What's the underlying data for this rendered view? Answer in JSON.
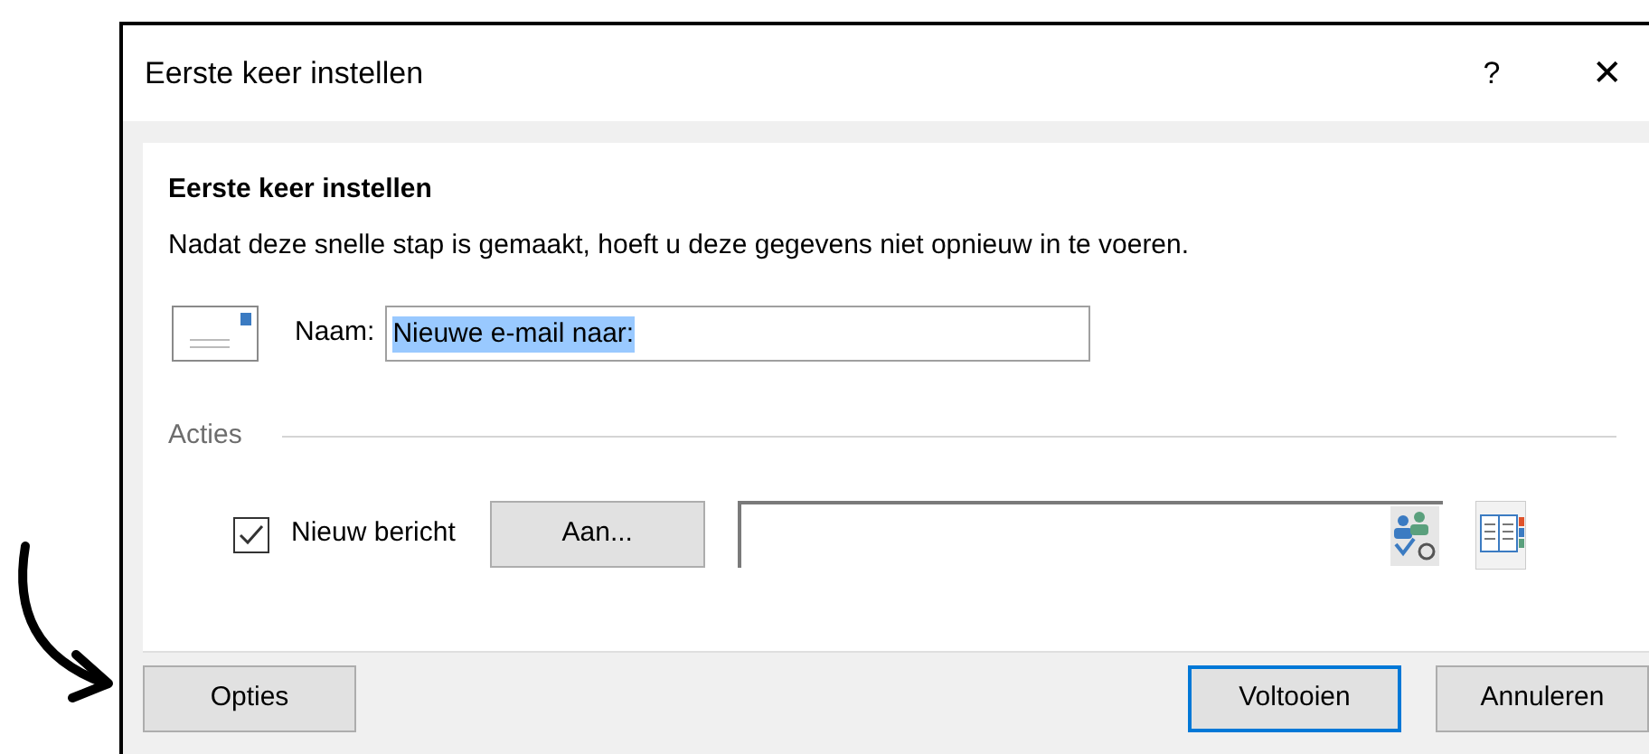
{
  "window": {
    "title": "Eerste keer instellen",
    "help": "?",
    "close": "✕"
  },
  "heading": "Eerste keer instellen",
  "description": "Nadat deze snelle stap is gemaakt, hoeft u deze gegevens niet opnieuw in te voeren.",
  "name_field": {
    "label": "Naam:",
    "value": "Nieuwe e-mail naar:",
    "selected": true
  },
  "actions": {
    "label": "Acties",
    "new_message": {
      "label": "Nieuw bericht",
      "checked": true
    },
    "to_button": "Aan..."
  },
  "buttons": [
    {
      "label": "Opties",
      "kind": "left",
      "default": false
    },
    {
      "label": "Voltooien",
      "kind": "right",
      "default": true
    },
    {
      "label": "Annuleren",
      "kind": "right",
      "default": false
    }
  ]
}
